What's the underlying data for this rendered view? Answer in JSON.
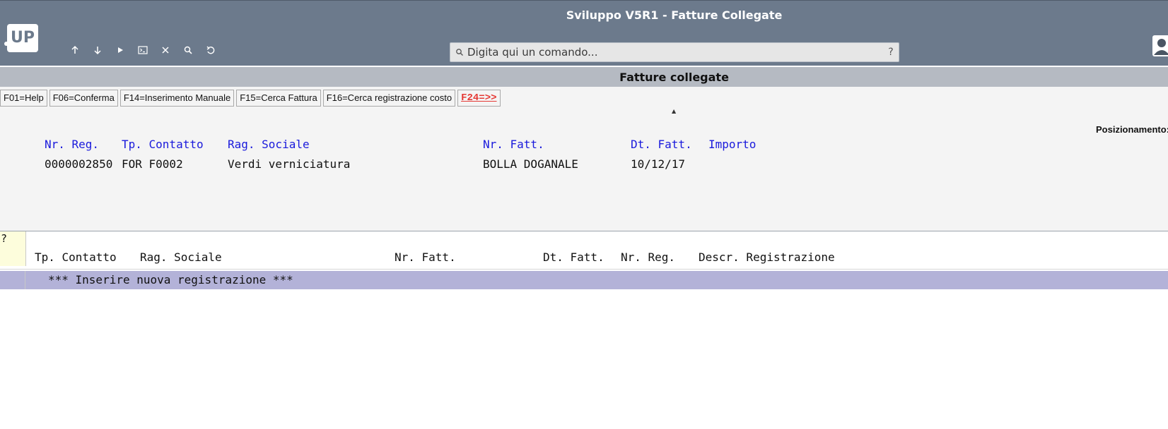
{
  "window": {
    "title": "Sviluppo V5R1 - Fatture Collegate",
    "logo_text": "UP"
  },
  "toolbar": {
    "buttons": [
      {
        "icon": "arrow-up-icon"
      },
      {
        "icon": "arrow-down-icon"
      },
      {
        "icon": "play-icon"
      },
      {
        "icon": "terminal-icon"
      },
      {
        "icon": "close-icon"
      },
      {
        "icon": "search-icon"
      },
      {
        "icon": "undo-icon"
      }
    ]
  },
  "search": {
    "placeholder": "Digita qui un comando...",
    "help": "?"
  },
  "screen": {
    "title": "Fatture collegate",
    "fkeys": [
      {
        "label": "F01=Help"
      },
      {
        "label": "F06=Conferma"
      },
      {
        "label": "F14=Inserimento Manuale"
      },
      {
        "label": "F15=Cerca Fattura"
      },
      {
        "label": "F16=Cerca registrazione costo"
      },
      {
        "label": "F24=>>"
      }
    ],
    "positioning_label": "Posizionamento:"
  },
  "header_fields": {
    "labels": {
      "nr_reg": "Nr. Reg.",
      "tp_contatto": "Tp. Contatto",
      "rag_sociale": "Rag. Sociale",
      "nr_fatt": "Nr. Fatt.",
      "dt_fatt": "Dt. Fatt.",
      "importo": "Importo"
    },
    "values": {
      "nr_reg": "0000002850",
      "tp_contatto": "FOR F0002",
      "rag_sociale": "Verdi verniciatura",
      "nr_fatt": "BOLLA DOGANALE",
      "dt_fatt": "10/12/17",
      "importo": ""
    }
  },
  "list": {
    "selection_prompt": "?",
    "columns": {
      "tp_contatto": "Tp. Contatto",
      "rag_sociale": "Rag. Sociale",
      "nr_fatt": "Nr. Fatt.",
      "dt_fatt": "Dt. Fatt.",
      "nr_reg": "Nr. Reg.",
      "descr": "Descr. Registrazione"
    },
    "rows": [
      {
        "text": "*** Inserire nuova registrazione ***"
      }
    ]
  },
  "colors": {
    "topbar": "#6c7a8c",
    "subheader": "#b5bac2",
    "field_label": "#1a1adc",
    "highlight_row": "#b3b2d8",
    "fkey_red": "#e53935"
  }
}
